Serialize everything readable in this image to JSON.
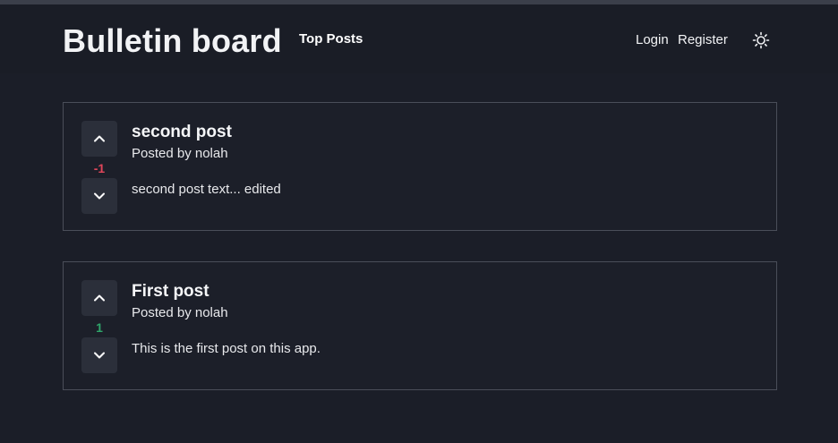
{
  "app": {
    "brand": "Bulletin board",
    "nav_top_posts": "Top Posts",
    "login": "Login",
    "register": "Register",
    "theme_icon": "sun-icon"
  },
  "colors": {
    "negative_score": "#e0465a",
    "positive_score": "#2fa56a"
  },
  "posts": [
    {
      "title": "second post",
      "author": "Posted by nolah",
      "body": "second post text... edited",
      "score": "-1"
    },
    {
      "title": "First post",
      "author": "Posted by nolah",
      "body": "This is the first post on this app.",
      "score": "1"
    }
  ]
}
